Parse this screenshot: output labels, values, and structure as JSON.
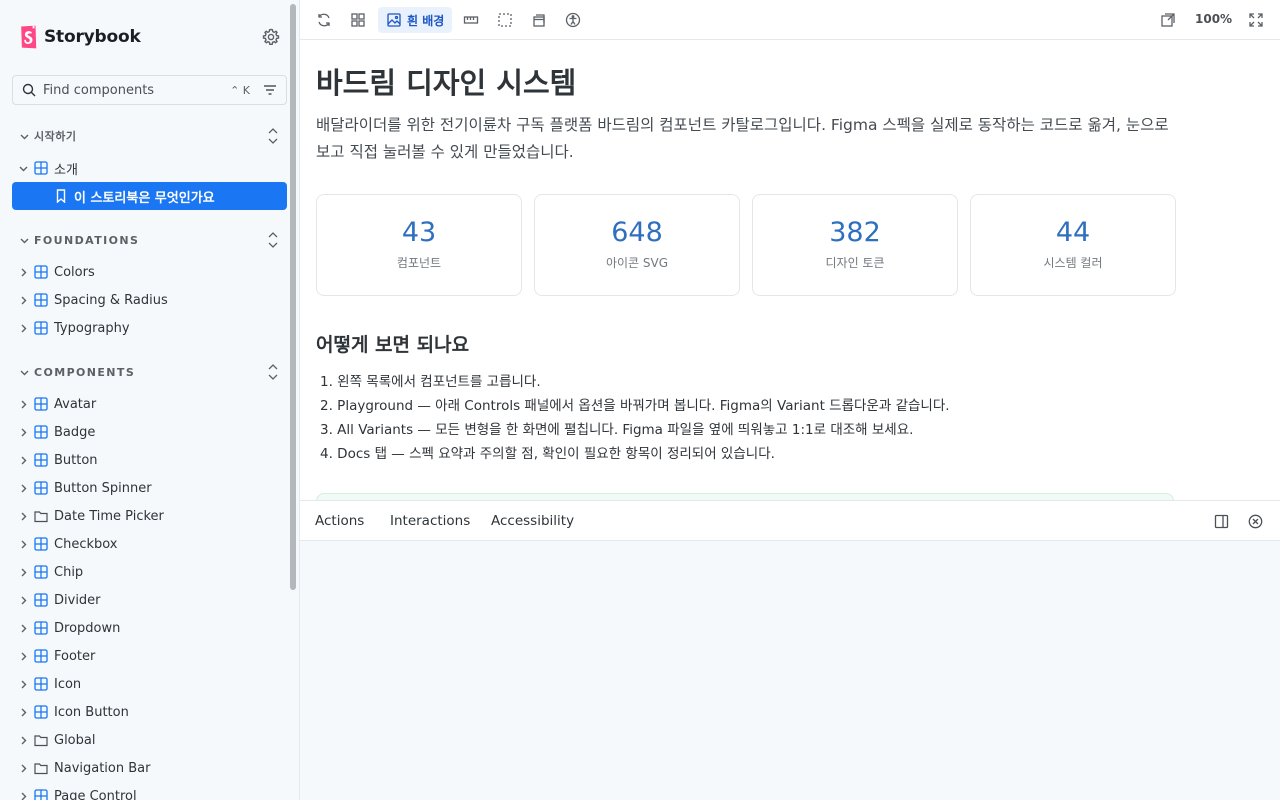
{
  "app": {
    "brand": "Storybook",
    "accent_color": "#1a76f2",
    "brand_color": "#ff4785"
  },
  "search": {
    "placeholder": "Find components",
    "shortcut": "⌃ K"
  },
  "sidebar": {
    "sections": [
      {
        "label": "시작하기",
        "items": [
          {
            "label": "소개",
            "icon": "component-icon",
            "expanded": true
          },
          {
            "label": "이 스토리북은 무엇인가요",
            "icon": "bookmark-icon",
            "selected": true
          }
        ]
      },
      {
        "label": "FOUNDATIONS",
        "items": [
          {
            "label": "Colors",
            "icon": "component-icon"
          },
          {
            "label": "Spacing & Radius",
            "icon": "component-icon"
          },
          {
            "label": "Typography",
            "icon": "component-icon"
          }
        ]
      },
      {
        "label": "COMPONENTS",
        "items": [
          {
            "label": "Avatar",
            "icon": "component-icon"
          },
          {
            "label": "Badge",
            "icon": "component-icon"
          },
          {
            "label": "Button",
            "icon": "component-icon"
          },
          {
            "label": "Button Spinner",
            "icon": "component-icon"
          },
          {
            "label": "Date Time Picker",
            "icon": "folder-icon"
          },
          {
            "label": "Checkbox",
            "icon": "component-icon"
          },
          {
            "label": "Chip",
            "icon": "component-icon"
          },
          {
            "label": "Divider",
            "icon": "component-icon"
          },
          {
            "label": "Dropdown",
            "icon": "component-icon"
          },
          {
            "label": "Footer",
            "icon": "component-icon"
          },
          {
            "label": "Icon",
            "icon": "component-icon"
          },
          {
            "label": "Icon Button",
            "icon": "component-icon"
          },
          {
            "label": "Global",
            "icon": "folder-icon"
          },
          {
            "label": "Navigation Bar",
            "icon": "folder-icon"
          },
          {
            "label": "Page Control",
            "icon": "component-icon"
          }
        ]
      }
    ]
  },
  "toolbar": {
    "background_label": "흰 배경",
    "zoom": "100%"
  },
  "doc": {
    "title": "바드림 디자인 시스템",
    "intro": "배달라이더를 위한 전기이륜차 구독 플랫폼 바드림의 컴포넌트 카탈로그입니다. Figma 스펙을 실제로 동작하는 코드로 옮겨, 눈으로 보고 직접 눌러볼 수 있게 만들었습니다.",
    "stats": [
      {
        "value": "43",
        "label": "컴포넌트"
      },
      {
        "value": "648",
        "label": "아이콘 SVG"
      },
      {
        "value": "382",
        "label": "디자인 토큰"
      },
      {
        "value": "44",
        "label": "시스템 컬러"
      }
    ],
    "howto_title": "어떻게 보면 되나요",
    "steps": [
      "1. 왼쪽 목록에서 컴포넌트를 고릅니다.",
      "2. Playground — 아래 Controls 패널에서 옵션을 바꿔가며 봅니다. Figma의 Variant 드롭다운과 같습니다.",
      "3. All Variants — 모든 변형을 한 화면에 펼칩니다. Figma 파일을 옆에 띄워놓고 1:1로 대조해 보세요.",
      "4. Docs 탭 — 스펙 요약과 주의할 점, 확인이 필요한 항목이 정리되어 있습니다."
    ]
  },
  "panel": {
    "tabs": [
      "Actions",
      "Interactions",
      "Accessibility"
    ]
  }
}
